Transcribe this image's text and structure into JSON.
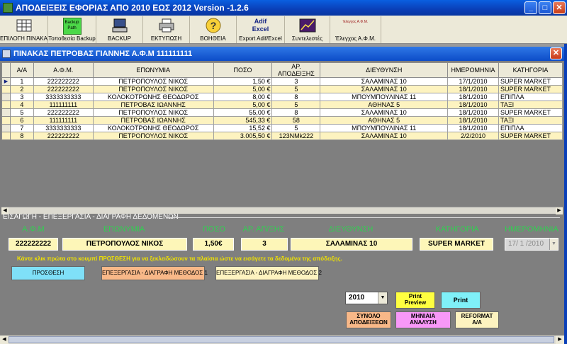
{
  "window": {
    "title": "ΑΠΟΔΕΙΞΕΙΣ ΕΦΟΡΙΑΣ ΑΠΟ 2010 ΕΩΣ 2012  Version -1.2.6"
  },
  "toolbar": [
    {
      "label": "ΕΠΙΛΟΓΗ ΠΙΝΑΚΑ",
      "icon": "table-icon"
    },
    {
      "label": "Τοποθεσία Backup",
      "icon": "backup-path-icon",
      "icon_text": "Backup Path"
    },
    {
      "label": "BACKUP",
      "icon": "computer-icon"
    },
    {
      "label": "ΕΚΤΥΠΩΣΗ",
      "icon": "printer-icon"
    },
    {
      "label": "ΒΟΗΘΕΙΑ",
      "icon": "help-icon"
    },
    {
      "label": "Export Adif/Excel",
      "icon": "excel-icon",
      "icon_text": "Adif Excel"
    },
    {
      "label": "Συντελεστές",
      "icon": "chart-icon"
    },
    {
      "label": "Έλεγχος Α.Φ.Μ.",
      "icon": "afm-check-icon",
      "icon_text": "Έλεγχος Α.Φ.Μ."
    }
  ],
  "child_window": {
    "title": "ΠΙΝΑΚΑΣ ΠΕΤΡΟΒΑΣ ΓΙΑΝΝΗΣ Α.Φ.Μ 111111111"
  },
  "grid": {
    "columns": [
      "Α/Α",
      "Α.Φ.Μ.",
      "ΕΠΩΝΥΜΙΑ",
      "ΠΟΣΟ",
      "ΑΡ. ΑΠΟΔΕΙΞΗΣ",
      "ΔΙΕΥΘΥΝΣΗ",
      "ΗΜΕΡΟΜΗΝΙΑ",
      "ΚΑΤΗΓΟΡΙΑ"
    ],
    "rows": [
      [
        "1",
        "222222222",
        "ΠΕΤΡΟΠΟΥΛΟΣ ΝΙΚΟΣ",
        "1,50 €",
        "3",
        "ΣΑΛΑΜΙΝΑΣ 10",
        "17/1/2010",
        "SUPER MARKET"
      ],
      [
        "2",
        "222222222",
        "ΠΕΤΡΟΠΟΥΛΟΣ ΝΙΚΟΣ",
        "5,00 €",
        "5",
        "ΣΑΛΑΜΙΝΑΣ 10",
        "18/1/2010",
        "SUPER MARKET"
      ],
      [
        "3",
        "3333333333",
        "ΚΟΛΟΚΟΤΡΩΝΗΣ ΘΕΟΔΩΡΟΣ",
        "8,00 €",
        "8",
        "ΜΠΟΥΜΠΟΥΛΙΝΑΣ 11",
        "18/1/2010",
        "ΕΠΙΠΛΑ"
      ],
      [
        "4",
        "111111111",
        "ΠΕΤΡΟΒΑΣ ΙΩΑΝΝΗΣ",
        "5,00 €",
        "5",
        "ΑΘΗΝΑΣ 5",
        "18/1/2010",
        "ΤΑΞΙ"
      ],
      [
        "5",
        "222222222",
        "ΠΕΤΡΟΠΟΥΛΟΣ ΝΙΚΟΣ",
        "55,00 €",
        "8",
        "ΣΑΛΑΜΙΝΑΣ 10",
        "18/1/2010",
        "SUPER MARKET"
      ],
      [
        "6",
        "111111111",
        "ΠΕΤΡΟΒΑΣ ΙΩΑΝΝΗΣ",
        "545,33 €",
        "58",
        "ΑΘΗΝΑΣ 5",
        "18/1/2010",
        "ΤΑΞΙ"
      ],
      [
        "7",
        "3333333333",
        "ΚΟΛΟΚΟΤΡΩΝΗΣ ΘΕΟΔΩΡΟΣ",
        "15,52 €",
        "5",
        "ΜΠΟΥΜΠΟΥΛΙΝΑΣ 11",
        "18/1/2010",
        "ΕΠΙΠΛΑ"
      ],
      [
        "8",
        "222222222",
        "ΠΕΤΡΟΠΟΥΛΟΣ ΝΙΚΟΣ",
        "3.005,50 €",
        "123ΝΜk222",
        "ΣΑΛΑΜΙΝΑΣ 10",
        "2/2/2010",
        "SUPER MARKET"
      ]
    ]
  },
  "entry": {
    "section_title": "ΕΙΣΑΓΩΓΗ - ΕΠΕΞΕΡΓΑΣΙΑ - ΔΙΑΓΡΑΦΗ ΔΕΔΟΜΕΝΩΝ",
    "labels": {
      "afm": "Α.Φ.Μ",
      "name": "ΕΠΩΝΥΜΙΑ",
      "amount": "ΠΟΣΟ",
      "receipt": "ΑΡ. ΑΠ/ΞΗΣ",
      "address": "ΔΙΕΥΘΥΝΣΗ",
      "category": "ΚΑΤΗΓΟΡΙΑ",
      "date": "ΗΜΕΡΟΜΗΝΙΑ"
    },
    "values": {
      "afm": "222222222",
      "name": "ΠΕΤΡΟΠΟΥΛΟΣ ΝΙΚΟΣ",
      "amount": "1,50€",
      "receipt": "3",
      "address": "ΣΑΛΑΜΙΝΑΣ 10",
      "category": "SUPER MARKET",
      "date": "17/ 1 /2010"
    },
    "hint": "Κάντε κλικ πρώτα στο κουμπί ΠΡΟΣΘΕΣΗ για να ξεκλειδώσουν τα πλαίσια ώστε να εισάγετε τα δεδομένα της απόδειξης."
  },
  "buttons": {
    "add": "ΠΡΟΣΘΕΣΗ",
    "edit1": "ΕΠΕΞΕΡΓΑΣΙΑ - ΔΙΑΓΡΑΦΗ ΜΕΘΟΔΟΣ 1",
    "edit2": "ΕΠΕΞΕΡΓΑΣΙΑ - ΔΙΑΓΡΑΦΗ ΜΕΘΟΔΟΣ 2",
    "print_preview_1": "Print",
    "print_preview_2": "Preview",
    "print": "Print",
    "total_1": "ΣΥΝΟΛΟ",
    "total_2": "ΑΠΟΔΕΙΞΕΩΝ",
    "monthly_1": "ΜΗΝΙΑΙΑ",
    "monthly_2": "ΑΝΑΛΥΣΗ",
    "reformat_1": "REFORMAT",
    "reformat_2": "Α/Α"
  },
  "year_select": {
    "value": "2010"
  },
  "colors": {
    "field_label_green": "#30d050",
    "hint_yellow": "#f0e200",
    "row_alt": "#fdf3c0",
    "add_btn": "#7fe0f8",
    "edit1_btn": "#f8b888",
    "edit2_btn": "#fdf3c0",
    "preview_btn": "#ffff40",
    "print_btn": "#7ff0f8",
    "total_btn": "#f8b888",
    "monthly_btn": "#f898f8",
    "reformat_btn": "#fdf3c0"
  }
}
